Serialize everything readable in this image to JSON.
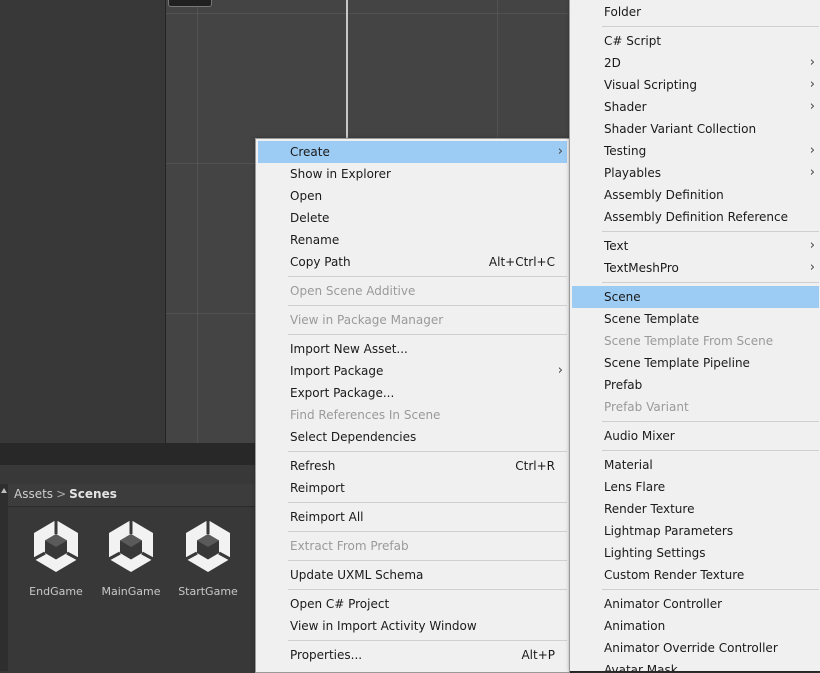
{
  "project": {
    "breadcrumb_root": "Assets",
    "breadcrumb_current": "Scenes",
    "assets": [
      {
        "name": "EndGame",
        "icon": "unity-scene-icon"
      },
      {
        "name": "MainGame",
        "icon": "unity-scene-icon"
      },
      {
        "name": "StartGame",
        "icon": "unity-scene-icon"
      }
    ]
  },
  "context_menu": {
    "create": "Create",
    "show_in_explorer": "Show in Explorer",
    "open": "Open",
    "delete": "Delete",
    "rename": "Rename",
    "copy_path": "Copy Path",
    "copy_path_shortcut": "Alt+Ctrl+C",
    "open_scene_additive": "Open Scene Additive",
    "view_in_package_manager": "View in Package Manager",
    "import_new_asset": "Import New Asset...",
    "import_package": "Import Package",
    "export_package": "Export Package...",
    "find_references": "Find References In Scene",
    "select_dependencies": "Select Dependencies",
    "refresh": "Refresh",
    "refresh_shortcut": "Ctrl+R",
    "reimport": "Reimport",
    "reimport_all": "Reimport All",
    "extract_from_prefab": "Extract From Prefab",
    "update_uxml": "Update UXML Schema",
    "open_csharp_project": "Open C# Project",
    "view_import_activity": "View in Import Activity Window",
    "properties": "Properties...",
    "properties_shortcut": "Alt+P"
  },
  "create_menu": {
    "folder": "Folder",
    "csharp_script": "C# Script",
    "two_d": "2D",
    "visual_scripting": "Visual Scripting",
    "shader": "Shader",
    "shader_variant_collection": "Shader Variant Collection",
    "testing": "Testing",
    "playables": "Playables",
    "assembly_definition": "Assembly Definition",
    "assembly_definition_reference": "Assembly Definition Reference",
    "text": "Text",
    "textmeshpro": "TextMeshPro",
    "scene": "Scene",
    "scene_template": "Scene Template",
    "scene_template_from_scene": "Scene Template From Scene",
    "scene_template_pipeline": "Scene Template Pipeline",
    "prefab": "Prefab",
    "prefab_variant": "Prefab Variant",
    "audio_mixer": "Audio Mixer",
    "material": "Material",
    "lens_flare": "Lens Flare",
    "render_texture": "Render Texture",
    "lightmap_parameters": "Lightmap Parameters",
    "lighting_settings": "Lighting Settings",
    "custom_render_texture": "Custom Render Texture",
    "animator_controller": "Animator Controller",
    "animation": "Animation",
    "animator_override_controller": "Animator Override Controller",
    "avatar_mask": "Avatar Mask"
  },
  "colors": {
    "highlight": "#9ccbf3",
    "menu_bg": "#f0f0f0",
    "editor_bg": "#383838"
  }
}
